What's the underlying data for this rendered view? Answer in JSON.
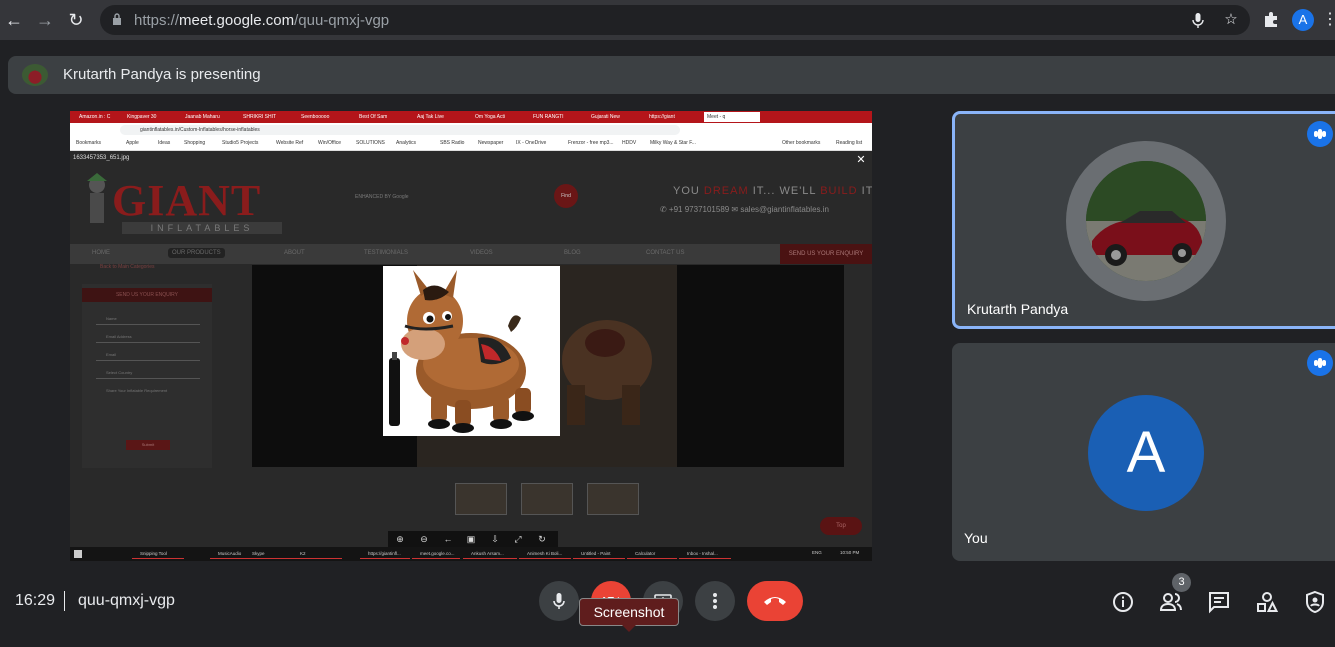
{
  "browser": {
    "url_scheme": "https://",
    "url_host": "meet.google.com",
    "url_path": "/quu-qmxj-vgp",
    "profile_initial": "A",
    "icons": [
      "back-arrow-icon",
      "forward-arrow-icon",
      "reload-icon",
      "lock-icon",
      "microphone-icon",
      "star-icon",
      "puzzle-icon",
      "kebab-menu-icon"
    ]
  },
  "presenting": {
    "text": "Krutarth Pandya is presenting"
  },
  "shared_screen": {
    "tabs": [
      "Amazon.in : C",
      "Kingpaver 30",
      "Jaanab Maharu",
      "SHRIKRI SHIT",
      "Seenbooooo",
      "Best Of Sam",
      "Aaj Tak Live",
      "Om Yoga Acti",
      "FUN RANGTI",
      "Gujarati New",
      "https://giant",
      "Meet - q"
    ],
    "inner_url": "giantinflatables.in/Custom-Inflatables/horse-inflatables",
    "bookmarks": [
      "Bookmarks",
      "Apple",
      "Ideas",
      "Shopping",
      "Studio5 Projects",
      "Website Ref",
      "Win/Office",
      "SOLUTIONS",
      "Analytics",
      "SBS Radio",
      "Newspaper",
      "IX - OneDrive",
      "Frenzor - free mp3...",
      "HDDV",
      "Milky Way & Star F...",
      "Other bookmarks",
      "Reading list"
    ],
    "filename": "1633457353_651.jpg",
    "logo_text": "GIANT",
    "logo_sub": "INFLATABLES",
    "google_search": "ENHANCED BY Google",
    "find_btn": "Find",
    "slogan_part1": "YOU ",
    "slogan_dream": "DREAM",
    "slogan_part2": " IT... WE'LL ",
    "slogan_build": "BUILD",
    "slogan_part3": " IT",
    "contact": "✆ +91 9737101589  ✉ sales@giantinflatables.in",
    "nav": [
      "HOME",
      "OUR PRODUCTS",
      "ABOUT",
      "TESTIMONIALS",
      "VIDEOS",
      "BLOG",
      "CONTACT US"
    ],
    "enquiry_btn": "SEND US YOUR ENQUIRY",
    "back_link": "Back to Main Categories",
    "form_header": "SEND US YOUR ENQUIRY",
    "form_fields": [
      "Name",
      "Email Address",
      "Email",
      "Select Country",
      "Share Your Inflatable Requirement"
    ],
    "form_submit": "Submit",
    "to_top": "Top",
    "taskbar": [
      "Snipping Tool",
      "MusicAudio",
      "Skype",
      "K2",
      "https://giantinfl...",
      "meet.google.co...",
      "Ankush Arsam...",
      "Animesh Ki Boli...",
      "Untitled - Paint",
      "Calculator",
      "Inbox - Inshal..."
    ],
    "taskbar_time": "10:50 PM",
    "taskbar_lang": "ENG"
  },
  "participants": [
    {
      "name": "Krutarth Pandya",
      "avatar": "car-photo-avatar",
      "speaking": true,
      "pinned_border": true
    },
    {
      "name": "You",
      "avatar_initial": "A",
      "speaking": true,
      "pinned_border": false
    }
  ],
  "controls": {
    "time": "16:29",
    "meeting_code": "quu-qmxj-vgp",
    "tooltip": "Screenshot",
    "people_count": "3",
    "accent": "#8ab4f8",
    "hangup_color": "#ea4335",
    "icons": [
      "microphone-icon",
      "camera-off-icon",
      "present-screen-icon",
      "more-options-icon",
      "hangup-icon",
      "info-icon",
      "people-icon",
      "chat-icon",
      "activities-icon",
      "host-controls-icon"
    ]
  }
}
